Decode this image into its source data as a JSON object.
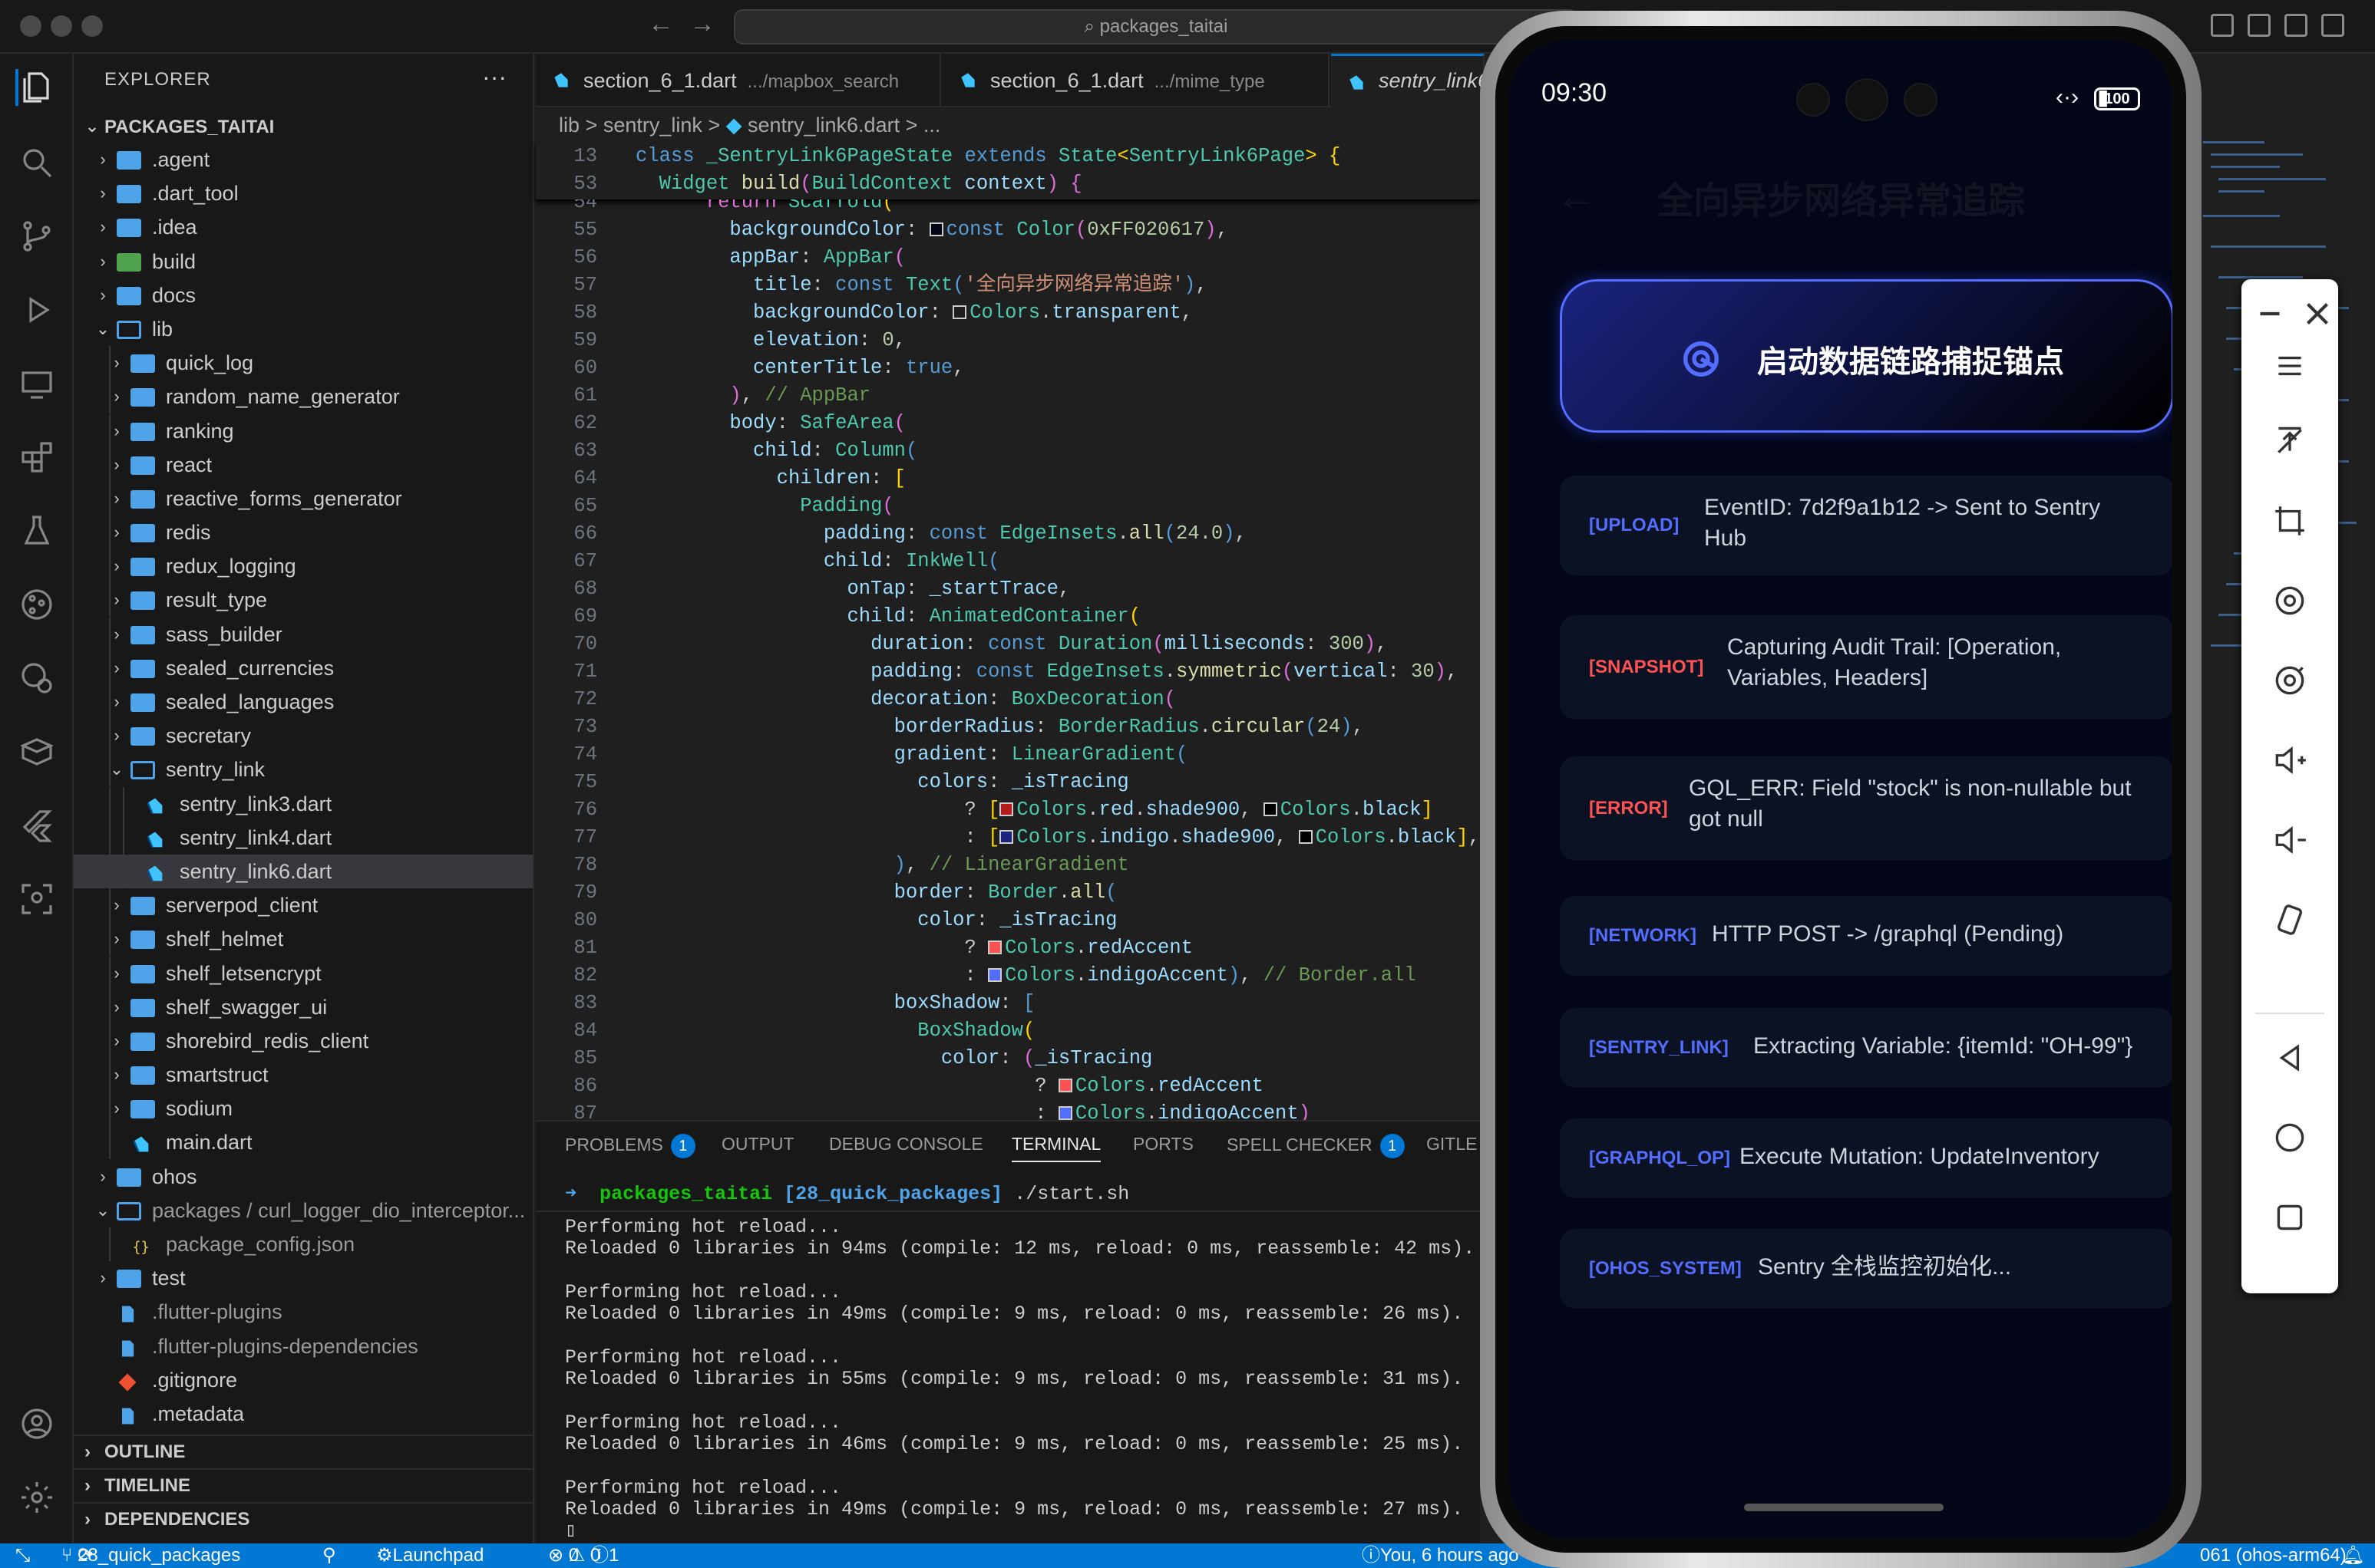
{
  "window": {
    "search_text": "packages_taitai"
  },
  "explorer": {
    "title": "EXPLORER",
    "more": "···",
    "root": "PACKAGES_TAITAI",
    "items": [
      {
        "label": ".agent",
        "type": "folder"
      },
      {
        "label": ".dart_tool",
        "type": "folder"
      },
      {
        "label": ".idea",
        "type": "folder"
      },
      {
        "label": "build",
        "type": "folder-build"
      },
      {
        "label": "docs",
        "type": "folder"
      },
      {
        "label": "lib",
        "type": "folder-open"
      },
      {
        "label": "quick_log",
        "type": "folder"
      },
      {
        "label": "random_name_generator",
        "type": "folder"
      },
      {
        "label": "ranking",
        "type": "folder"
      },
      {
        "label": "react",
        "type": "folder"
      },
      {
        "label": "reactive_forms_generator",
        "type": "folder"
      },
      {
        "label": "redis",
        "type": "folder"
      },
      {
        "label": "redux_logging",
        "type": "folder"
      },
      {
        "label": "result_type",
        "type": "folder"
      },
      {
        "label": "sass_builder",
        "type": "folder"
      },
      {
        "label": "sealed_currencies",
        "type": "folder"
      },
      {
        "label": "sealed_languages",
        "type": "folder"
      },
      {
        "label": "secretary",
        "type": "folder"
      },
      {
        "label": "sentry_link",
        "type": "folder-open"
      },
      {
        "label": "sentry_link3.dart",
        "type": "dart"
      },
      {
        "label": "sentry_link4.dart",
        "type": "dart"
      },
      {
        "label": "sentry_link6.dart",
        "type": "dart"
      },
      {
        "label": "serverpod_client",
        "type": "folder"
      },
      {
        "label": "shelf_helmet",
        "type": "folder"
      },
      {
        "label": "shelf_letsencrypt",
        "type": "folder"
      },
      {
        "label": "shelf_swagger_ui",
        "type": "folder"
      },
      {
        "label": "shorebird_redis_client",
        "type": "folder"
      },
      {
        "label": "smartstruct",
        "type": "folder"
      },
      {
        "label": "sodium",
        "type": "folder"
      },
      {
        "label": "main.dart",
        "type": "dart"
      },
      {
        "label": "ohos",
        "type": "folder"
      },
      {
        "label": "packages / curl_logger_dio_interceptor...",
        "type": "folder-open"
      },
      {
        "label": "package_config.json",
        "type": "json"
      },
      {
        "label": "test",
        "type": "folder"
      },
      {
        "label": ".flutter-plugins",
        "type": "file"
      },
      {
        "label": ".flutter-plugins-dependencies",
        "type": "file"
      },
      {
        "label": ".gitignore",
        "type": "git"
      },
      {
        "label": ".metadata",
        "type": "file"
      }
    ],
    "sections": [
      "OUTLINE",
      "TIMELINE",
      "DEPENDENCIES"
    ]
  },
  "tabs": [
    {
      "name": "section_6_1.dart",
      "desc": ".../mapbox_search"
    },
    {
      "name": "section_6_1.dart",
      "desc": ".../mime_type"
    },
    {
      "name": "sentry_link6.dart",
      "desc": ""
    }
  ],
  "breadcrumbs": [
    "lib",
    ">",
    "sentry_link",
    ">",
    "sentry_link6.dart",
    ">",
    "..."
  ],
  "panel": {
    "tabs": [
      "PROBLEMS",
      "OUTPUT",
      "DEBUG CONSOLE",
      "TERMINAL",
      "PORTS",
      "SPELL CHECKER",
      "GITLE"
    ],
    "problems_count": "1",
    "spell_count": "1",
    "prompt_dir": "packages_taitai",
    "prompt_branch": "[28_quick_packages]",
    "prompt_cmd": "./start.sh",
    "lines": [
      "Performing hot reload...",
      "Reloaded 0 libraries in 94ms (compile: 12 ms, reload: 0 ms, reassemble: 42 ms).",
      "",
      "Performing hot reload...",
      "Reloaded 0 libraries in 49ms (compile: 9 ms, reload: 0 ms, reassemble: 26 ms).",
      "",
      "Performing hot reload...",
      "Reloaded 0 libraries in 55ms (compile: 9 ms, reload: 0 ms, reassemble: 31 ms).",
      "",
      "Performing hot reload...",
      "Reloaded 0 libraries in 46ms (compile: 9 ms, reload: 0 ms, reassemble: 25 ms).",
      "",
      "Performing hot reload...",
      "Reloaded 0 libraries in 49ms (compile: 9 ms, reload: 0 ms, reassemble: 27 ms).",
      "▯"
    ]
  },
  "statusbar": {
    "branch": "28_quick_packages",
    "launchpad": "Launchpad",
    "errors": "0",
    "warnings": "0",
    "info": "1",
    "blame": "You, 6 hours ago",
    "device": "061 (ohos-arm64)"
  },
  "phone": {
    "time": "09:30",
    "battery": "100",
    "title": "全向异步网络异常追踪",
    "button_label": "启动数据链路捕捉锚点",
    "logs": [
      {
        "tag": "[UPLOAD]",
        "msg": "EventID: 7d2f9a1b12 -> Sent to Sentry Hub",
        "color": "#536dfe"
      },
      {
        "tag": "[SNAPSHOT]",
        "msg": "Capturing Audit Trail: [Operation, Variables, Headers]",
        "color": "#ff5252"
      },
      {
        "tag": "[ERROR]",
        "msg": "GQL_ERR: Field \"stock\" is non-nullable but got null",
        "color": "#ff5252"
      },
      {
        "tag": "[NETWORK]",
        "msg": "HTTP POST -> /graphql (Pending)",
        "color": "#536dfe"
      },
      {
        "tag": "[SENTRY_LINK]",
        "msg": "Extracting Variable: {itemId: \"OH-99\"}",
        "color": "#536dfe"
      },
      {
        "tag": "[GRAPHQL_OP]",
        "msg": "Execute Mutation: UpdateInventory",
        "color": "#536dfe"
      },
      {
        "tag": "[OHOS_SYSTEM]",
        "msg": "Sentry 全栈监控初始化...",
        "color": "#536dfe"
      }
    ]
  }
}
